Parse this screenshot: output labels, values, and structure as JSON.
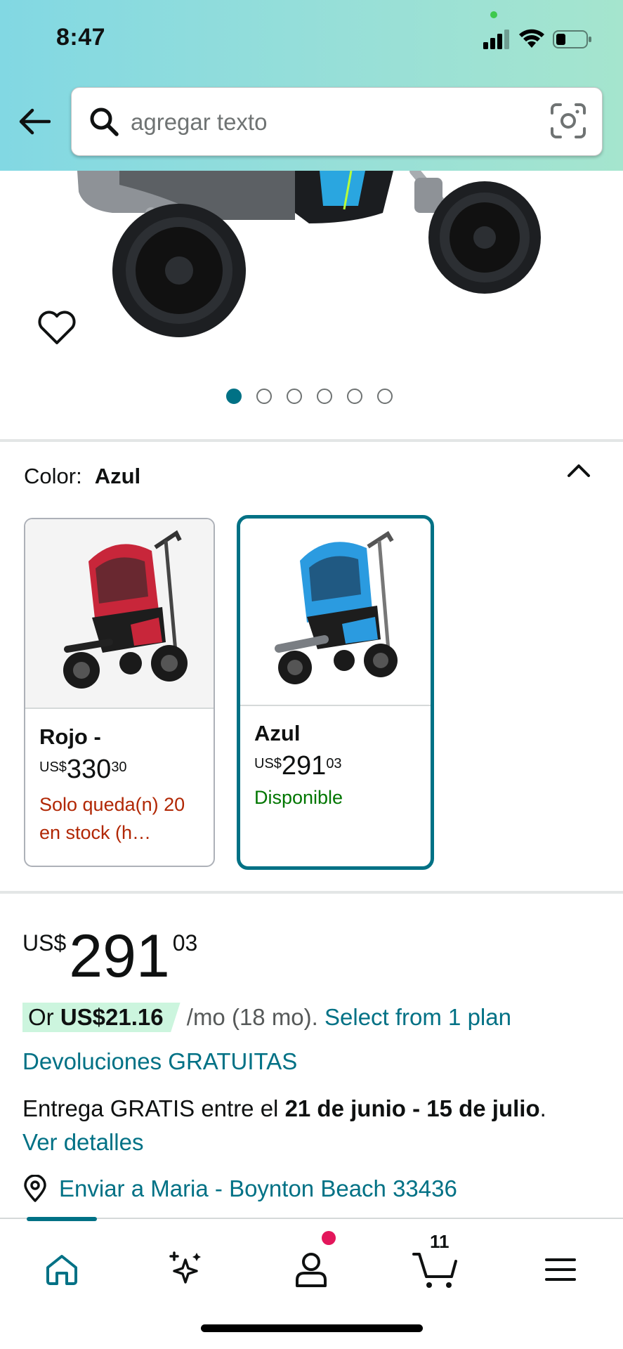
{
  "status_bar": {
    "time": "8:47"
  },
  "search": {
    "placeholder": "agregar texto"
  },
  "gallery": {
    "image_count": 6,
    "active_index": 0
  },
  "color": {
    "label": "Color:",
    "selected": "Azul",
    "options": [
      {
        "name": "Rojo -",
        "currency": "US$",
        "price_whole": "330",
        "price_fraction": "30",
        "stock": "Solo queda(n) 20 en stock (h…"
      },
      {
        "name": "Azul",
        "currency": "US$",
        "price_whole": "291",
        "price_fraction": "03",
        "stock": "Disponible"
      }
    ]
  },
  "price": {
    "currency": "US$",
    "whole": "291",
    "fraction": "03"
  },
  "plan": {
    "prefix": "Or ",
    "amount": "US$21.16",
    "middle": " /mo (18 mo). ",
    "link": "Select from 1 plan"
  },
  "returns": "Devoluciones GRATUITAS",
  "delivery": {
    "prefix": "Entrega GRATIS entre el ",
    "dates": "21 de junio - 15 de julio",
    "suffix": ".",
    "details_link": "Ver detalles"
  },
  "ship_to": "Enviar a Maria - Boynton Beach 33436",
  "bottom_nav": {
    "cart_count": "11",
    "items": [
      "home-icon",
      "sparkle-icon",
      "account-icon",
      "cart-icon",
      "menu-icon"
    ]
  },
  "colors": {
    "accent": "#007185",
    "red_text": "#b12704",
    "green_text": "#007600",
    "badge_bg": "#ccf5de"
  }
}
